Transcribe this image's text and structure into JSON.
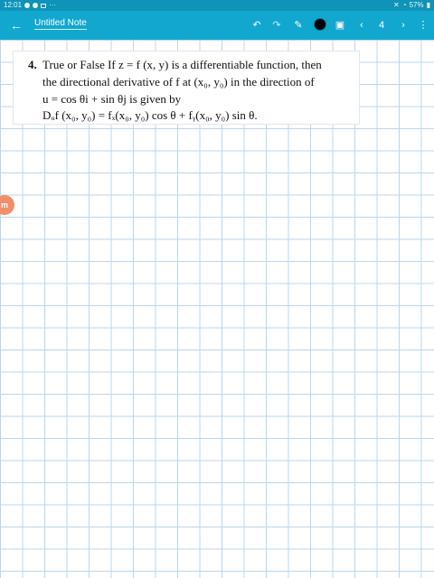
{
  "status_bar": {
    "time": "12:01",
    "ellipsis": "···",
    "battery": "57%"
  },
  "app_bar": {
    "title": "Untitled Note",
    "page_number": "4"
  },
  "problem": {
    "number": "4.",
    "line1": "True or False   If z = f (x, y) is a differentiable function, then",
    "line2": "the directional derivative of f at (x₀, y₀) in the direction of",
    "line3": "u = cos θi + sin θj is given by",
    "line4": "Dᵤf (x₀, y₀) = fₓ(x₀, y₀) cos θ + fᵧ(x₀, y₀) sin θ."
  },
  "icons": {
    "back": "arrow-left-icon",
    "undo": "undo-icon",
    "pen": "pen-icon",
    "color": "color-swatch-icon",
    "image": "image-icon",
    "prev": "chevron-left-icon",
    "next": "chevron-right-icon",
    "more": "more-vert-icon"
  },
  "colors": {
    "app_bar": "#12a7cf",
    "status_bar": "#0f93b8",
    "grid": "#b9d7ef",
    "badge": "#ef8f6b"
  }
}
